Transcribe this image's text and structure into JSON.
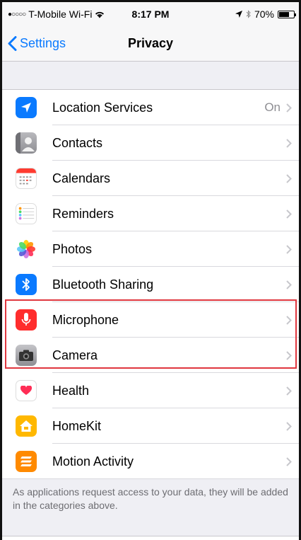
{
  "status_bar": {
    "carrier": "T-Mobile Wi-Fi",
    "time": "8:17 PM",
    "battery": "70%",
    "battery_level": 0.7
  },
  "nav": {
    "back_label": "Settings",
    "title": "Privacy"
  },
  "items": [
    {
      "label": "Location Services",
      "value": "On",
      "icon": "location-arrow-icon",
      "color": "#0a7aff"
    },
    {
      "label": "Contacts",
      "value": "",
      "icon": "contacts-icon",
      "color": "#8e8e93"
    },
    {
      "label": "Calendars",
      "value": "",
      "icon": "calendar-icon",
      "color": "#ffffff"
    },
    {
      "label": "Reminders",
      "value": "",
      "icon": "reminders-icon",
      "color": "#ffffff"
    },
    {
      "label": "Photos",
      "value": "",
      "icon": "photos-icon",
      "color": "#ffffff"
    },
    {
      "label": "Bluetooth Sharing",
      "value": "",
      "icon": "bluetooth-icon",
      "color": "#0a7aff"
    },
    {
      "label": "Microphone",
      "value": "",
      "icon": "microphone-icon",
      "color": "#ff2d2d"
    },
    {
      "label": "Camera",
      "value": "",
      "icon": "camera-icon",
      "color": "#8e8e93"
    },
    {
      "label": "Health",
      "value": "",
      "icon": "health-heart-icon",
      "color": "#ffffff"
    },
    {
      "label": "HomeKit",
      "value": "",
      "icon": "homekit-icon",
      "color": "#ffb800"
    },
    {
      "label": "Motion Activity",
      "value": "",
      "icon": "motion-activity-icon",
      "color": "#ff8a00"
    }
  ],
  "footer_note": "As applications request access to your data, they will be added in the categories above."
}
